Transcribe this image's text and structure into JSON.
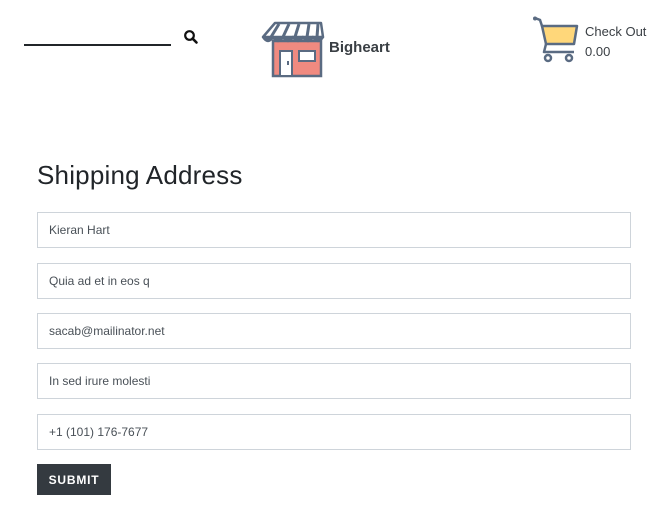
{
  "header": {
    "search": {
      "icon": "search-icon"
    },
    "brand": {
      "name": "Bigheart",
      "logo_icon": "storefront-icon"
    },
    "cart": {
      "icon": "shopping-cart-icon",
      "label": "Check Out",
      "total": "0.00"
    }
  },
  "form": {
    "title": "Shipping Address",
    "fields": [
      {
        "name": "full-name",
        "value": "Kieran Hart"
      },
      {
        "name": "address",
        "value": "Quia ad et in eos q"
      },
      {
        "name": "email",
        "value": "sacab@mailinator.net"
      },
      {
        "name": "city",
        "value": "In sed irure molesti"
      },
      {
        "name": "phone",
        "value": "+1 (101) 176-7677"
      }
    ],
    "submit_label": "SUBMIT"
  },
  "colors": {
    "text_dark": "#212529",
    "button_bg": "#343a40",
    "border": "#ced4da",
    "awning_blue": "#5a6b82",
    "shop_red": "#f08a80",
    "cart_yellow": "#ffd77a"
  }
}
